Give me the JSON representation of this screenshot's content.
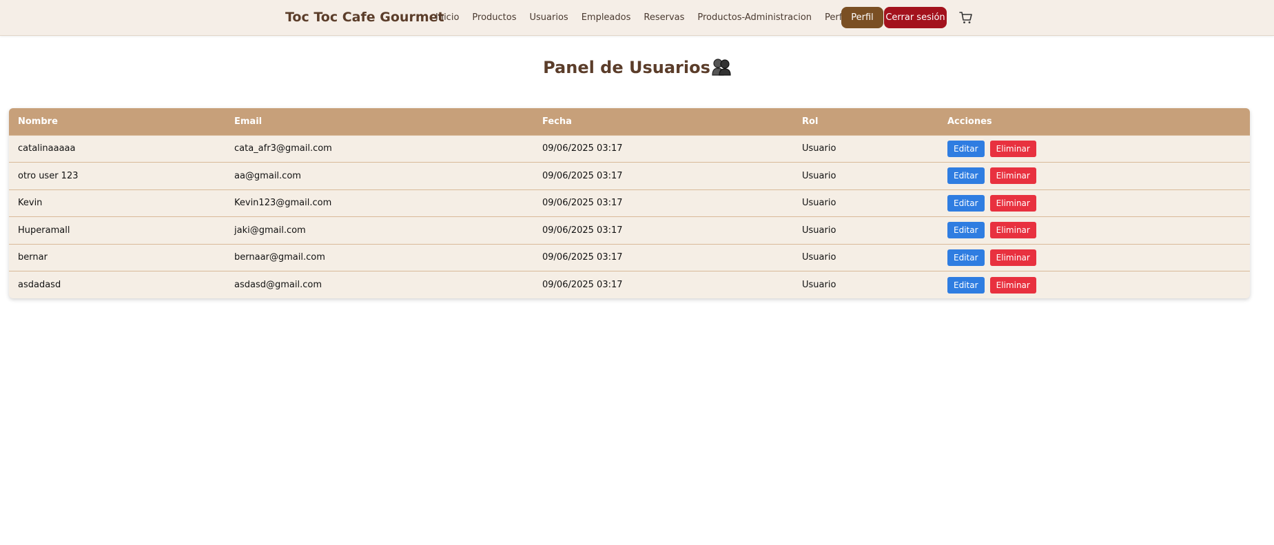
{
  "navbar": {
    "brand": "Toc Toc Cafe Gourmet",
    "links": [
      "Inicio",
      "Productos",
      "Usuarios",
      "Empleados",
      "Reservas",
      "Productos-Administracion",
      "Perfil"
    ],
    "perfil_button": "Perfil",
    "logout_button": "Cerrar sesión",
    "cart_icon": "cart-icon"
  },
  "page": {
    "title": "Panel de Usuarios",
    "title_icon": "users-icon"
  },
  "table": {
    "headers": [
      "Nombre",
      "Email",
      "Fecha",
      "Rol",
      "Acciones"
    ],
    "rows": [
      {
        "nombre": "catalinaaaaa",
        "email": "cata_afr3@gmail.com",
        "fecha": "09/06/2025 03:17",
        "rol": "Usuario"
      },
      {
        "nombre": "otro user 123",
        "email": "aa@gmail.com",
        "fecha": "09/06/2025 03:17",
        "rol": "Usuario"
      },
      {
        "nombre": "Kevin",
        "email": "Kevin123@gmail.com",
        "fecha": "09/06/2025 03:17",
        "rol": "Usuario"
      },
      {
        "nombre": "Huperamall",
        "email": "jaki@gmail.com",
        "fecha": "09/06/2025 03:17",
        "rol": "Usuario"
      },
      {
        "nombre": "bernar",
        "email": "bernaar@gmail.com",
        "fecha": "09/06/2025 03:17",
        "rol": "Usuario"
      },
      {
        "nombre": "asdadasd",
        "email": "asdasd@gmail.com",
        "fecha": "09/06/2025 03:17",
        "rol": "Usuario"
      }
    ],
    "edit_label": "Editar",
    "delete_label": "Eliminar"
  },
  "colors": {
    "brand": "#5b3d2a",
    "header_bg": "#c7a07a",
    "row_bg": "#f5eee5",
    "perfil_btn": "#7a4f23",
    "logout_btn": "#a3121d",
    "edit_btn": "#2f7de1",
    "delete_btn": "#e8313f"
  }
}
